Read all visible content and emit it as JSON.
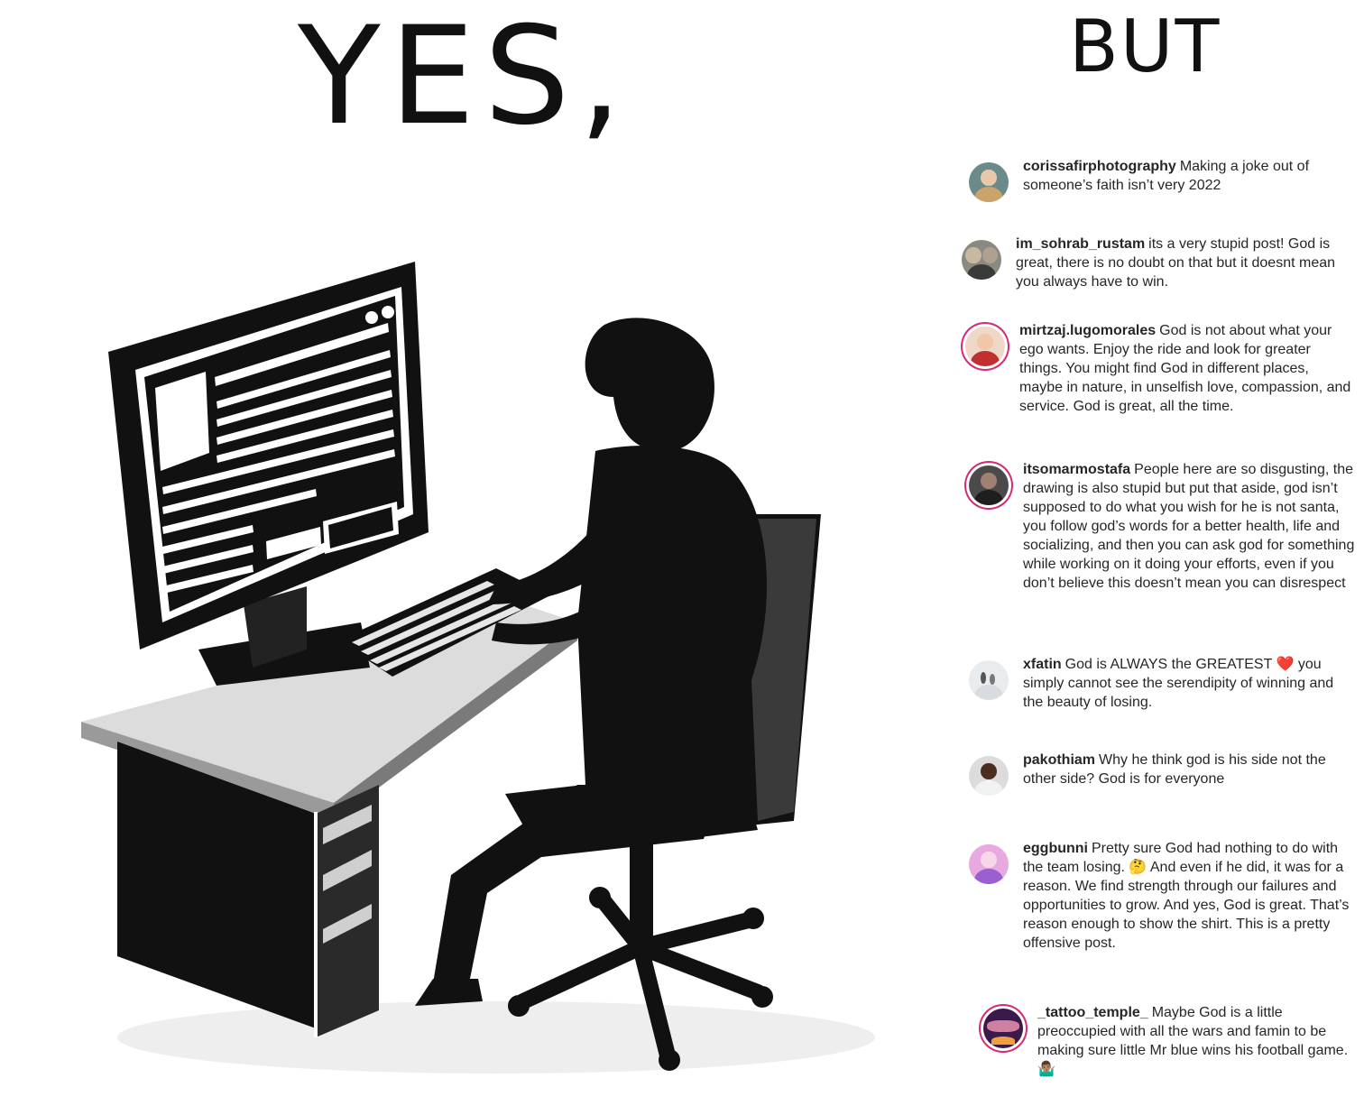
{
  "left_title": "YES,",
  "right_title": "BUT",
  "colors": {
    "background": "#ffffff",
    "ink": "#111111",
    "comment_text": "#262626",
    "story_ring": "#d62976",
    "heart": "#e0245e"
  },
  "comments": [
    {
      "username": "corissafirphotography",
      "text": "Making a joke out of someone’s faith isn’t very 2022",
      "avatar_icon": "profile-photo-woman",
      "story_ring": false
    },
    {
      "username": "im_sohrab_rustam",
      "text": "its a very stupid post! God is great, there is no doubt on that but it doesnt mean you always have to win.",
      "avatar_icon": "profile-photo-group",
      "story_ring": false
    },
    {
      "username": "mirtzaj.lugomorales",
      "text": "God is not about what your ego wants. Enjoy the ride and look for greater things. You might find God in different places, maybe in nature, in unselfish love, compassion, and service. God is great, all the time.",
      "avatar_icon": "profile-photo-woman-blonde",
      "story_ring": true
    },
    {
      "username": "itsomarmostafa",
      "text": "People here are so disgusting, the drawing is also stupid but put that aside, god isn’t supposed to do what you wish for he is not santa, you follow god’s words for a better health, life and socializing, and then you can ask god for something while working on it doing your efforts, even if you don’t believe this doesn’t mean you can disrespect",
      "avatar_icon": "profile-photo-man-beard",
      "story_ring": true
    },
    {
      "username": "xfatin",
      "text": "God is ALWAYS the GREATEST ❤️ you simply cannot see the serendipity of winning and the beauty of losing.",
      "avatar_icon": "profile-photo-couple-beach",
      "story_ring": false
    },
    {
      "username": "pakothiam",
      "text": "Why he think god is his side not the other side?  God is for everyone",
      "avatar_icon": "profile-photo-man",
      "story_ring": false
    },
    {
      "username": "eggbunni",
      "text": "Pretty sure God had nothing to do with the team losing. 🤔 And even if he did, it was for a reason. We find strength through our failures and opportunities to grow. And yes, God is great. That’s reason enough to show the shirt. This is a pretty offensive post.",
      "avatar_icon": "profile-photo-anime-girl",
      "story_ring": false
    },
    {
      "username": "_tattoo_temple_",
      "text": "Maybe God is a little preoccupied with all the wars and famin to be making sure little Mr blue wins his football game. 🤷🏽‍♂️",
      "avatar_icon": "profile-logo-tattoo-temple",
      "story_ring": true
    }
  ]
}
